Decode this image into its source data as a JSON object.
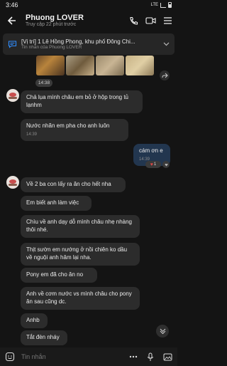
{
  "status_bar": {
    "time": "3:46",
    "network": "LTE"
  },
  "header": {
    "title": "Phuong LOVER",
    "subtitle": "Truy cập 22 phút trước"
  },
  "pinned": {
    "title": "[Vị trí] 1 Lê Hồng Phong, khu phố Đông Chi...",
    "subtitle": "Tin nhắn của Phuong LOVER"
  },
  "photo_time": "14:38",
  "messages": [
    {
      "text": "Chả lụa mình châu em bỏ ở hộp trong tủ lạnhm",
      "time": ""
    },
    {
      "text": "Nước nhãn em pha cho anh luôn",
      "time": "14:39"
    },
    {
      "text": "cám ơn e",
      "time": "14:39"
    },
    {
      "text": "Về 2 ba con lấy ra ăn cho hết nha",
      "time": ""
    },
    {
      "text": "Em biết anh làm việc",
      "time": ""
    },
    {
      "text": "Chìu về anh dạy dỗ mình châu nhẹ nhàng thôi nhé.",
      "time": ""
    },
    {
      "text": "Thịt sườn em nướng ở nồi chiên ko dầu về nguội anh hâm lại nha.",
      "time": ""
    },
    {
      "text": "Pony em đã cho ăn no",
      "time": ""
    },
    {
      "text": "Anh về cơm nước vs mình châu cho pony ăn sau cũng dc.",
      "time": ""
    },
    {
      "text": "Anhb",
      "time": ""
    },
    {
      "text": "Tắt đèn nháy",
      "time": ""
    }
  ],
  "reaction": {
    "emoji": "heart-icon",
    "count": "1"
  },
  "composer": {
    "placeholder": "Tin nhắn"
  },
  "colors": {
    "accent": "#2f8cff",
    "outgoing_bubble": "#22364f",
    "incoming_bubble": "#2c2c2c"
  }
}
